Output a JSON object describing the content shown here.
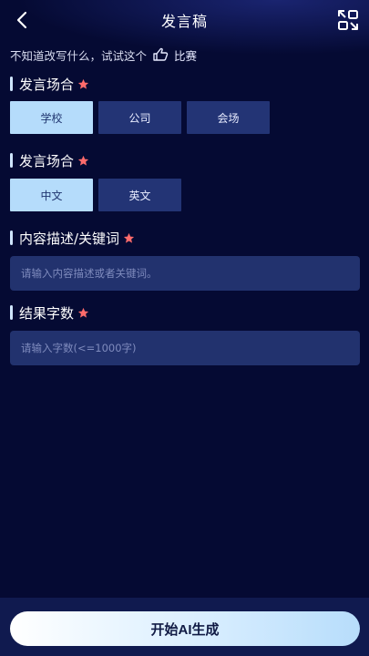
{
  "header": {
    "title": "发言稿",
    "back_icon": "chevron-left-icon",
    "history_icon": "history-swap-icon"
  },
  "hint": {
    "text": "不知道改写什么，试试这个",
    "icon": "pointing-hand-icon",
    "link_label": "比赛"
  },
  "sections": {
    "occasion": {
      "title": "发言场合",
      "options": [
        "学校",
        "公司",
        "会场"
      ],
      "selected": "学校"
    },
    "language": {
      "title": "发言场合",
      "options": [
        "中文",
        "英文"
      ],
      "selected": "中文"
    },
    "keywords": {
      "title": "内容描述/关键词",
      "value": "",
      "placeholder": "请输入内容描述或者关键词。"
    },
    "word_count": {
      "title": "结果字数",
      "value": "",
      "placeholder": "请输入字数(<=1000字)"
    }
  },
  "footer": {
    "start_label": "开始AI生成"
  },
  "colors": {
    "background": "#050a33",
    "option_bg": "#233475",
    "option_selected_bg": "#b5dcfb",
    "input_bg": "#22326e",
    "required_star": "#ff6b6b",
    "accent_bar": "#cfe6ff"
  }
}
